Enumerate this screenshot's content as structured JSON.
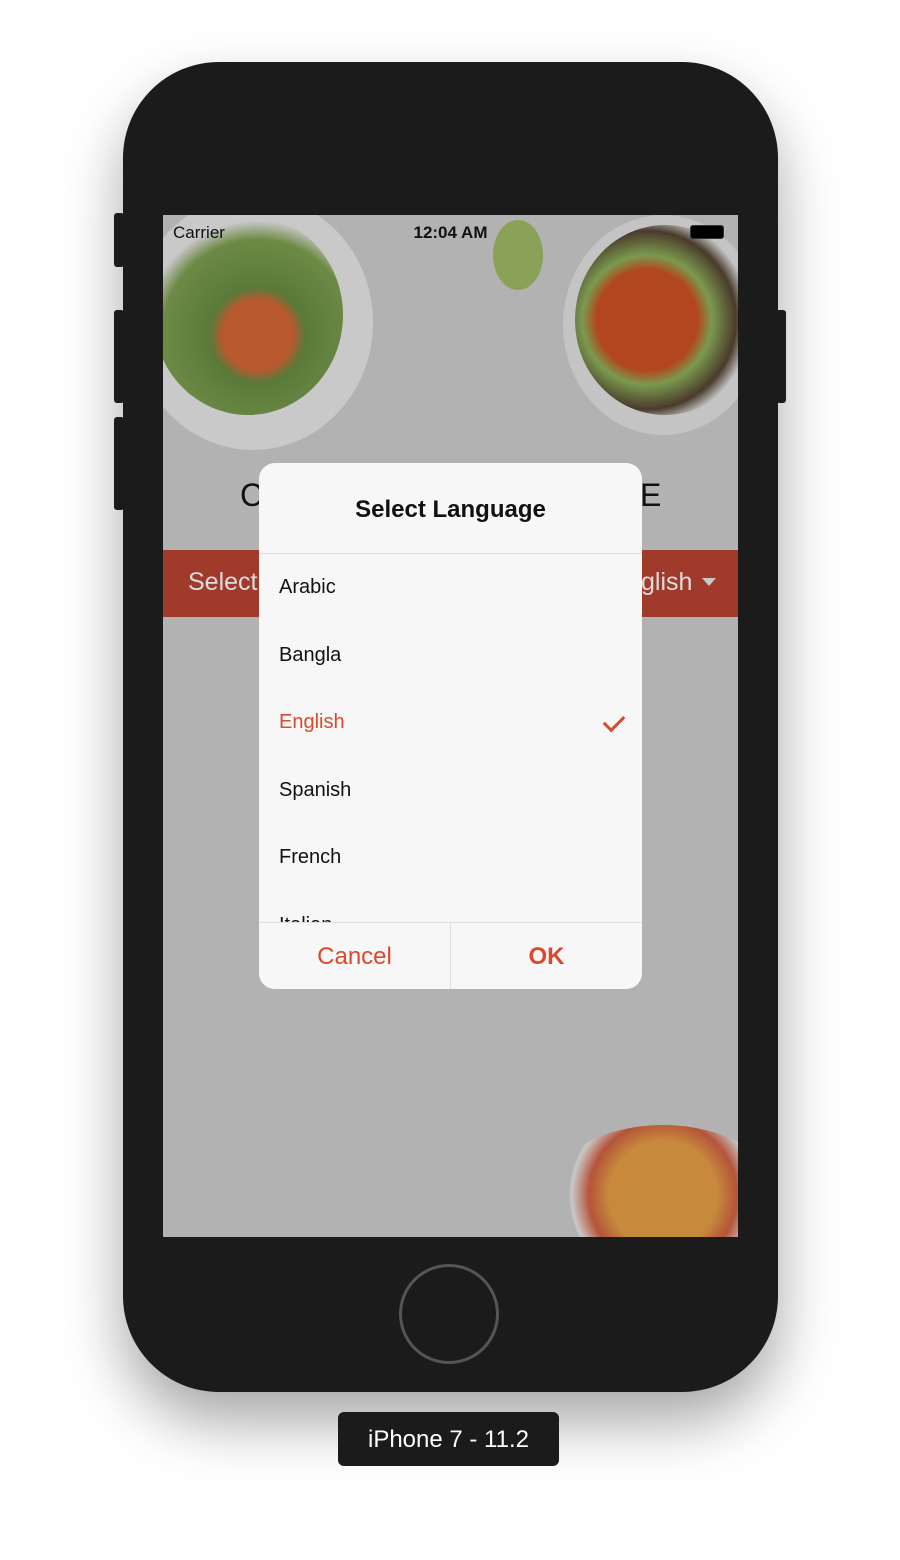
{
  "device_label": "iPhone 7 - 11.2",
  "status_bar": {
    "carrier": "Carrier",
    "time": "12:04 AM"
  },
  "background": {
    "title_left_fragment": "C",
    "title_right_fragment": "E",
    "select_left_fragment": "Select",
    "select_right_fragment": "glish"
  },
  "dialog": {
    "title": "Select Language",
    "items": [
      {
        "label": "Arabic",
        "selected": false
      },
      {
        "label": "Bangla",
        "selected": false
      },
      {
        "label": "English",
        "selected": true
      },
      {
        "label": "Spanish",
        "selected": false
      },
      {
        "label": "French",
        "selected": false
      },
      {
        "label": "Italian",
        "selected": false
      }
    ],
    "cancel_label": "Cancel",
    "ok_label": "OK"
  },
  "colors": {
    "accent": "#d9492e",
    "bar": "#a03a2a"
  }
}
